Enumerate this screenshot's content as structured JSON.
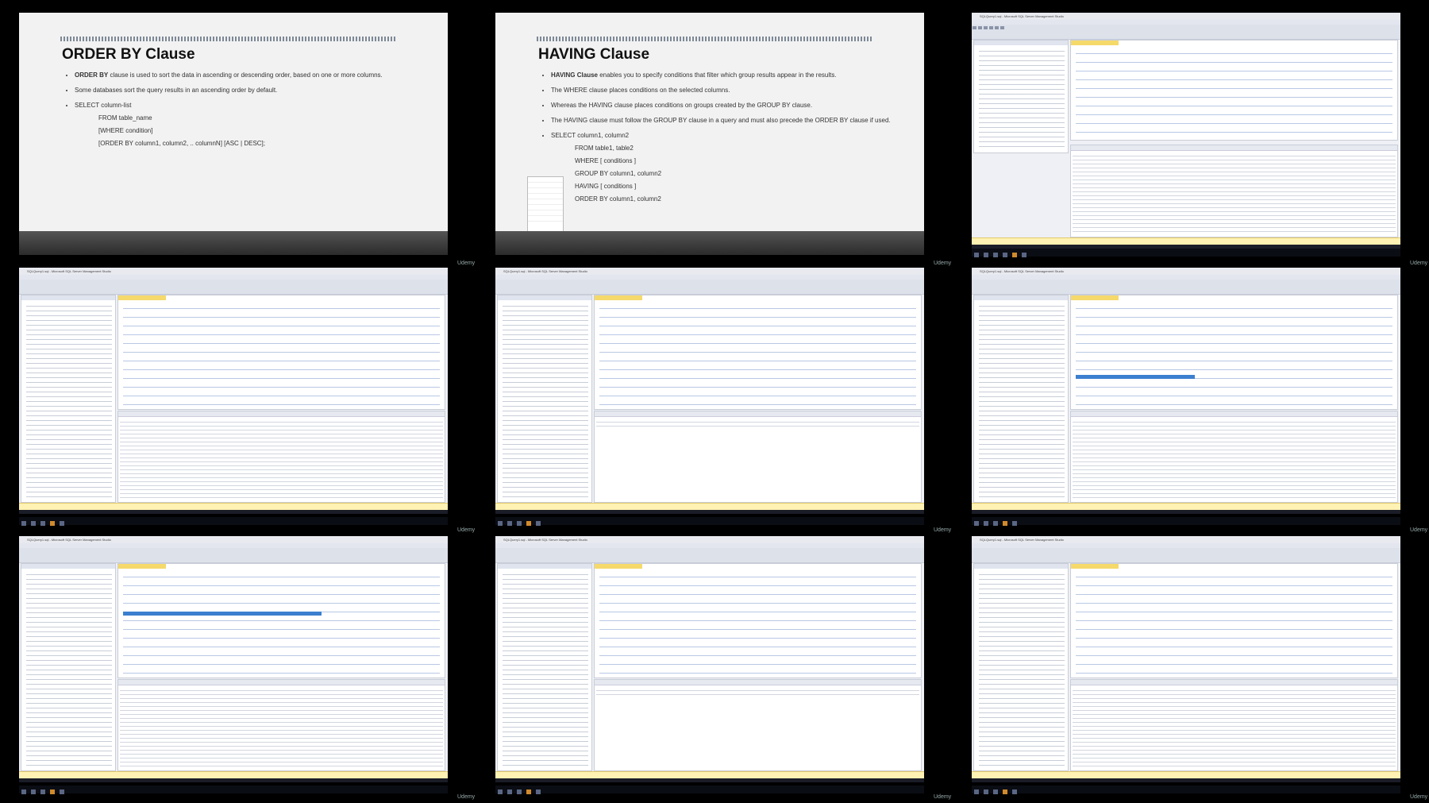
{
  "watermark": "Udemy",
  "slide_order_by": {
    "title": "ORDER BY Clause",
    "b1_keyword": "ORDER BY",
    "b1_text": " clause is used to sort the data in ascending or descending order, based on one or more columns.",
    "b2": "Some databases sort the query results in an ascending order by default.",
    "b3": "SELECT column-list",
    "b3_l1": "FROM table_name",
    "b3_l2": "[WHERE condition]",
    "b3_l3": "[ORDER BY column1, column2, .. columnN] [ASC | DESC];"
  },
  "slide_having": {
    "title": "HAVING Clause",
    "b1_keyword": "HAVING Clause",
    "b1_text": " enables you to specify conditions that filter which group results appear in the results.",
    "b2": "The WHERE clause places conditions on the selected columns.",
    "b3": "Whereas the HAVING clause places conditions on groups created by the GROUP BY clause.",
    "b4": "The HAVING clause must follow the GROUP BY clause in a query and must also precede the ORDER BY clause if used.",
    "b5": "SELECT column1, column2",
    "b5_l1": "FROM table1, table2",
    "b5_l2": "WHERE [ conditions ]",
    "b5_l3": "GROUP BY column1, column2",
    "b5_l4": "HAVING [ conditions ]",
    "b5_l5": "ORDER BY column1, column2"
  },
  "ssms_window_title": "SQLQuery1.sql - Microsoft SQL Server Management Studio"
}
